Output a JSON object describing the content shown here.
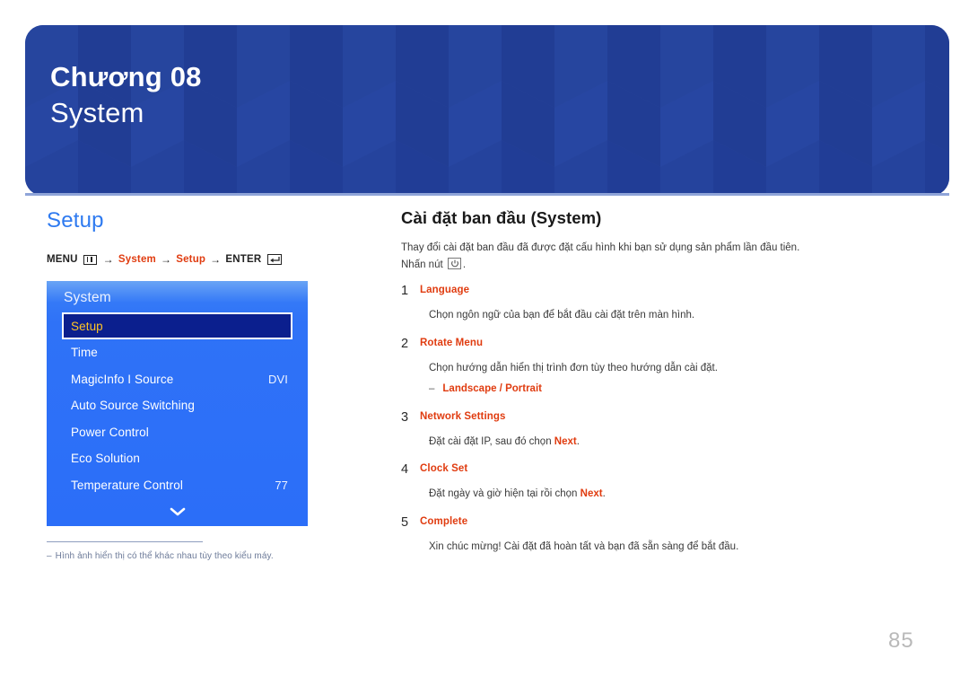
{
  "banner": {
    "chapter_label": "Chương 08",
    "chapter_title": "System",
    "bg_color": "#23409a"
  },
  "left": {
    "section_title": "Setup",
    "breadcrumb": {
      "menu_label": "MENU",
      "menu_icon": "menu-bars-icon",
      "arrow": "→",
      "path_1": "System",
      "path_2": "Setup",
      "enter_label": "ENTER",
      "enter_icon": "enter-return-icon",
      "hot_color": "#e03c10"
    },
    "osd": {
      "title": "System",
      "selected_text_color": "#ffc425",
      "items": [
        {
          "label": "Setup",
          "value": "",
          "selected": true
        },
        {
          "label": "Time",
          "value": "",
          "selected": false
        },
        {
          "label": "MagicInfo I Source",
          "value": "DVI",
          "selected": false
        },
        {
          "label": "Auto Source Switching",
          "value": "",
          "selected": false
        },
        {
          "label": "Power Control",
          "value": "",
          "selected": false
        },
        {
          "label": "Eco Solution",
          "value": "",
          "selected": false
        },
        {
          "label": "Temperature Control",
          "value": "77",
          "selected": false
        }
      ],
      "more_icon": "chevron-down-icon"
    },
    "footnote": {
      "dash": "‒",
      "text": "Hình ảnh hiển thị có thể khác nhau tùy theo kiểu máy."
    }
  },
  "right": {
    "title": "Cài đặt ban đầu (System)",
    "intro_line1": "Thay đổi cài đặt ban đầu đã được đặt cấu hình khi bạn sử dụng sản phẩm lần đầu tiên.",
    "intro_line2_prefix": "Nhấn nút",
    "intro_line2_icon": "power-button-icon",
    "intro_line2_suffix": ".",
    "steps": [
      {
        "num": "1",
        "name": "Language",
        "body": "Chọn ngôn ngữ của bạn để bắt đầu cài đặt trên màn hình.",
        "bullet_dash": "",
        "bullet": ""
      },
      {
        "num": "2",
        "name": "Rotate Menu",
        "body": "Chọn hướng dẫn hiển thị trình đơn tùy theo hướng dẫn cài đặt.",
        "bullet_dash": "‒",
        "bullet": "Landscape / Portrait"
      },
      {
        "num": "3",
        "name": "Network Settings",
        "body_pre": "Đặt cài đặt IP, sau đó chọn ",
        "body_hot": "Next",
        "body_post": ".",
        "bullet_dash": "",
        "bullet": ""
      },
      {
        "num": "4",
        "name": "Clock Set",
        "body_pre": "Đặt ngày và giờ hiện tại rồi chọn ",
        "body_hot": "Next",
        "body_post": ".",
        "bullet_dash": "",
        "bullet": ""
      },
      {
        "num": "5",
        "name": "Complete",
        "body": "Xin chúc mừng! Cài đặt đã hoàn tất và bạn đã sẵn sàng để bắt đầu.",
        "bullet_dash": "",
        "bullet": ""
      }
    ]
  },
  "page_number": "85"
}
